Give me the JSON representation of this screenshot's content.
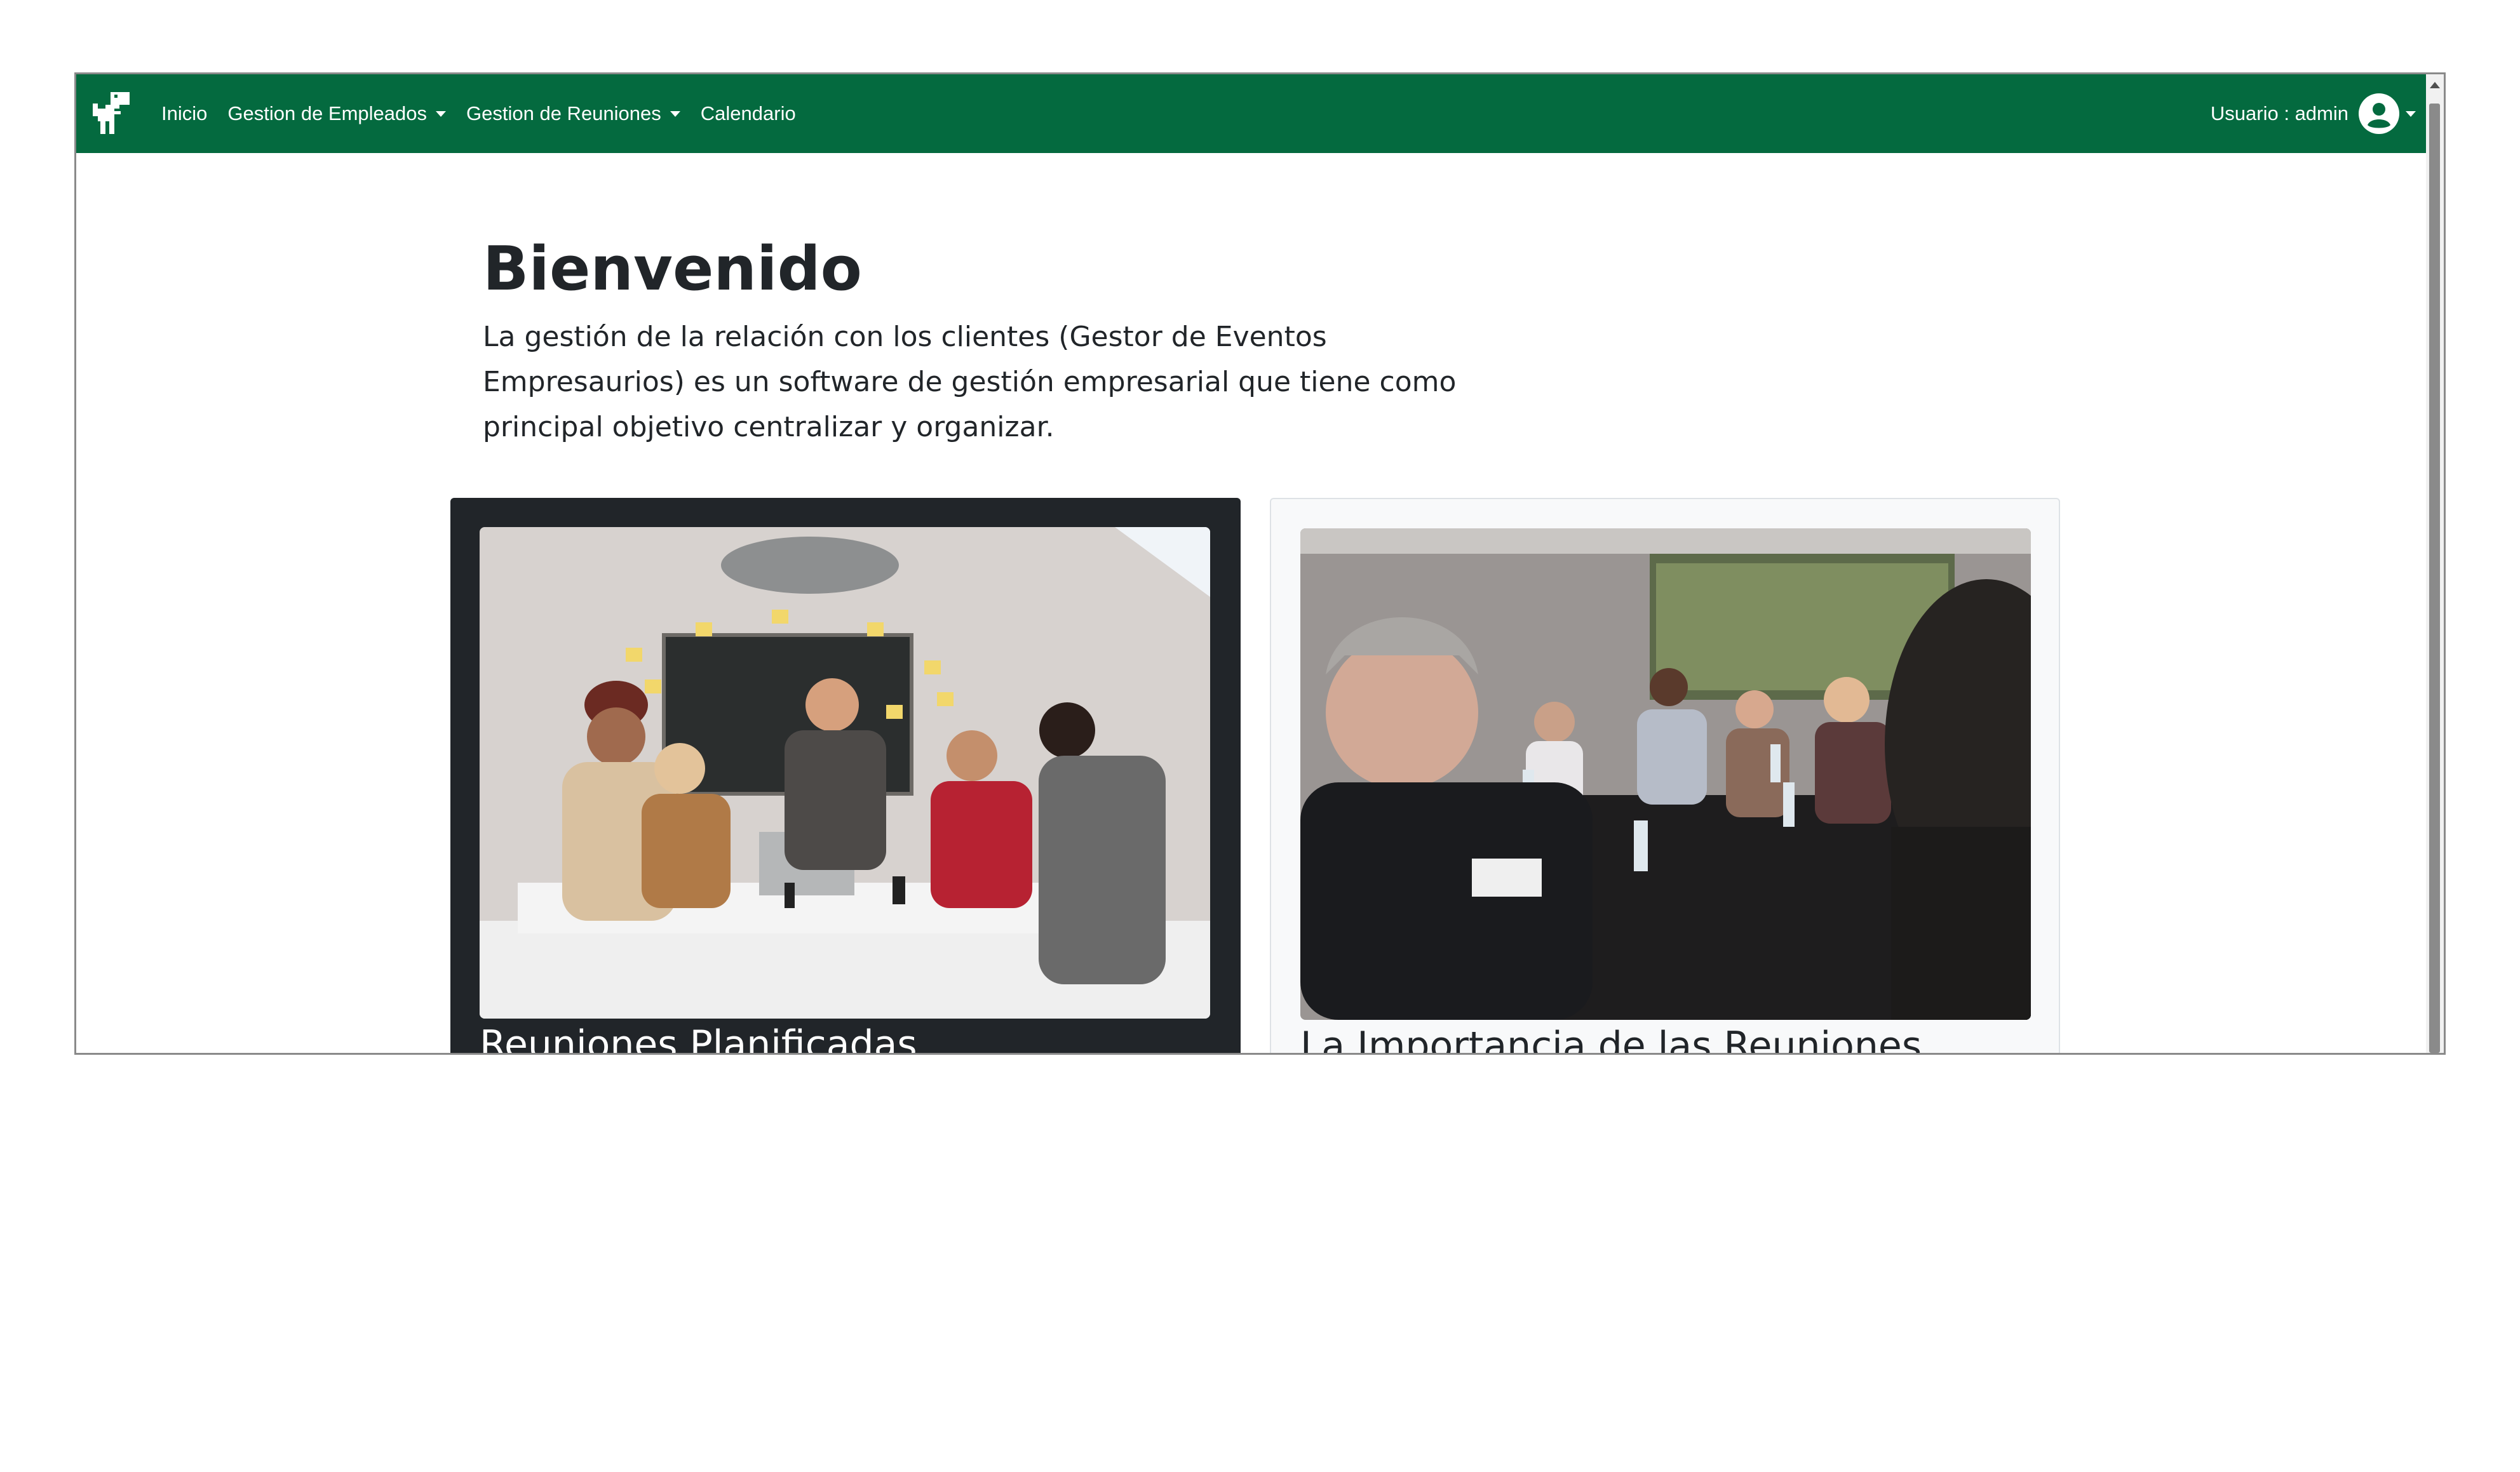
{
  "navbar": {
    "brand_icon": "dinosaur-logo-icon",
    "items": [
      {
        "label": "Inicio",
        "dropdown": false
      },
      {
        "label": "Gestion de Empleados",
        "dropdown": true
      },
      {
        "label": "Gestion de Reuniones",
        "dropdown": true
      },
      {
        "label": "Calendario",
        "dropdown": false
      }
    ],
    "user_label": "Usuario : admin",
    "user_icon": "user-circle-icon",
    "color": "#046a3f"
  },
  "hero": {
    "title": "Bienvenido",
    "description": "La gestión de la relación con los clientes (Gestor de Eventos Empresaurios) es un software de gestión empresarial que tiene como principal objetivo centralizar y organizar."
  },
  "cards": [
    {
      "title": "Reuniones Planificadas",
      "image": "team-meeting-photo",
      "theme": "dark"
    },
    {
      "title": "La Importancia de las Reuniones",
      "image": "conference-room-photo",
      "theme": "light"
    }
  ]
}
